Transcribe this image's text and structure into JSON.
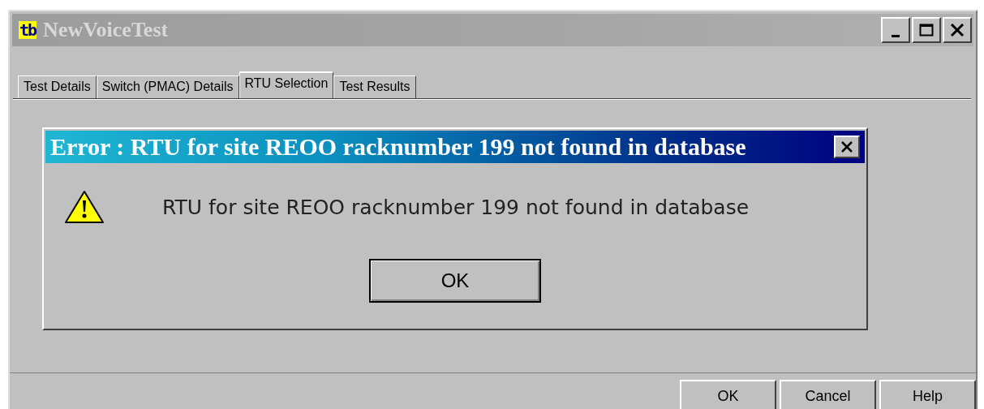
{
  "window": {
    "title": "NewVoiceTest",
    "app_icon_text": "tb"
  },
  "tabs": [
    {
      "label": "Test Details",
      "selected": false
    },
    {
      "label": "Switch (PMAC) Details",
      "selected": false
    },
    {
      "label": "RTU Selection",
      "selected": true
    },
    {
      "label": "Test Results",
      "selected": false
    }
  ],
  "dialog": {
    "title": "Error : RTU for site REOO racknumber 199 not found in database",
    "message": "RTU for site REOO racknumber 199 not found in database",
    "button": "OK"
  },
  "buttons": [
    "OK",
    "Cancel",
    "Help"
  ]
}
